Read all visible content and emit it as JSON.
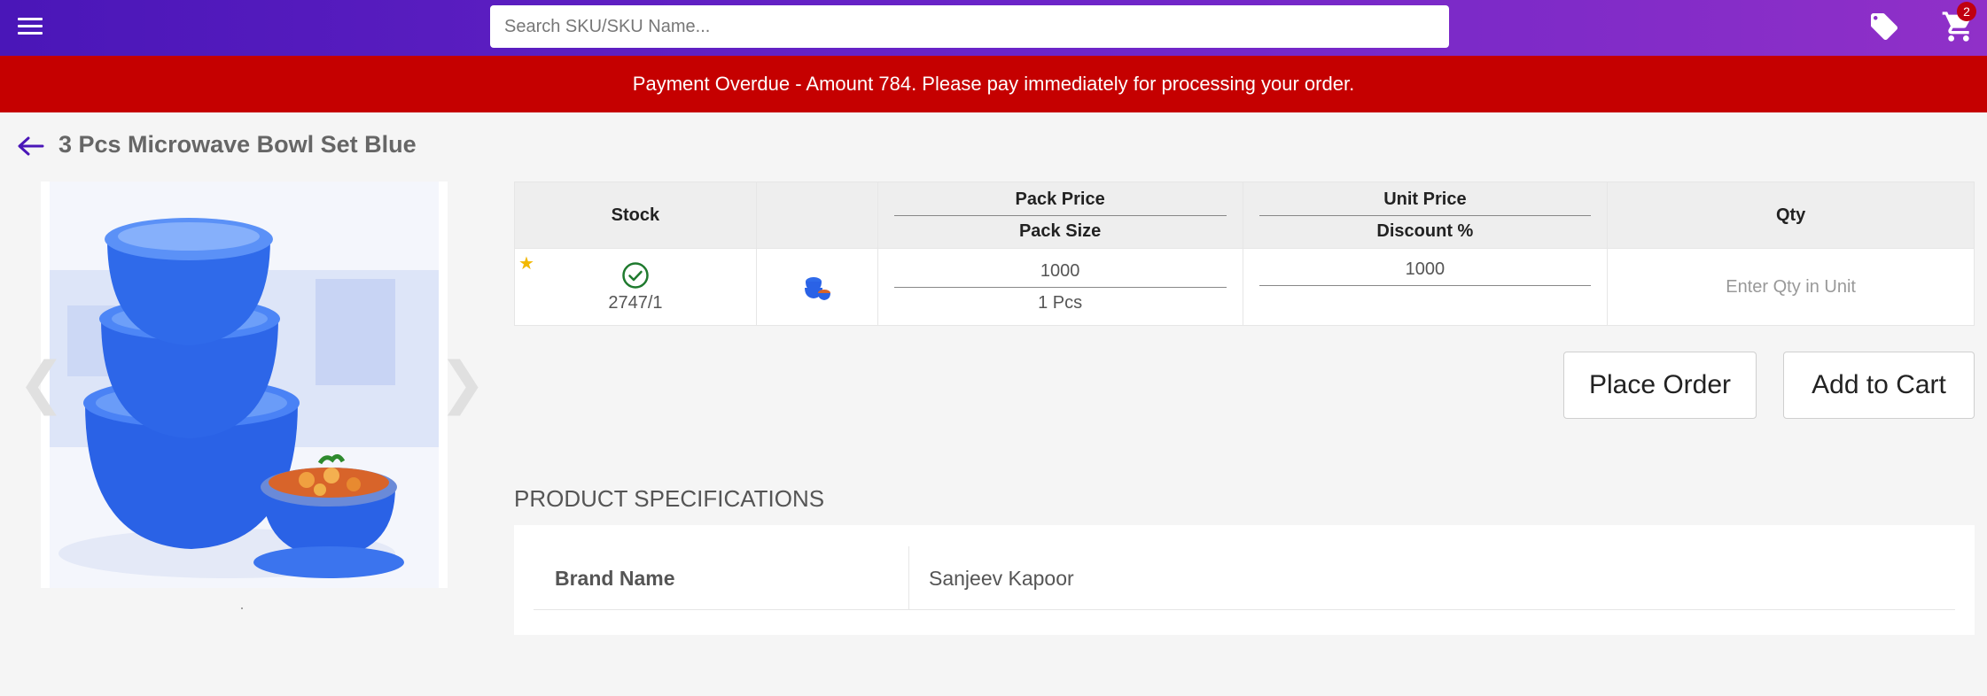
{
  "header": {
    "search_placeholder": "Search SKU/SKU Name...",
    "cart_count": "2",
    "gradient_colors": [
      "#4a16b8",
      "#9030c8"
    ]
  },
  "alert": {
    "message": "Payment Overdue - Amount 784. Please pay immediately for processing your order.",
    "color": "#c50000"
  },
  "product": {
    "title": "3 Pcs Microwave Bowl Set Blue"
  },
  "gallery": {
    "prev_glyph": "❮",
    "next_glyph": "❯"
  },
  "table": {
    "headers": {
      "stock": "Stock",
      "pack_price": "Pack Price",
      "pack_size": "Pack Size",
      "unit_price": "Unit Price",
      "discount": "Discount %",
      "qty": "Qty"
    },
    "row": {
      "star": "★",
      "stock": "2747/1",
      "pack_price": "1000",
      "pack_size": "1 Pcs",
      "unit_price": "1000",
      "discount": "",
      "qty_placeholder": "Enter Qty in Unit"
    }
  },
  "actions": {
    "place_order": "Place Order",
    "add_to_cart": "Add to Cart"
  },
  "specs": {
    "heading": "PRODUCT SPECIFICATIONS",
    "items": [
      {
        "label": "Brand Name",
        "value": "Sanjeev Kapoor"
      }
    ]
  }
}
